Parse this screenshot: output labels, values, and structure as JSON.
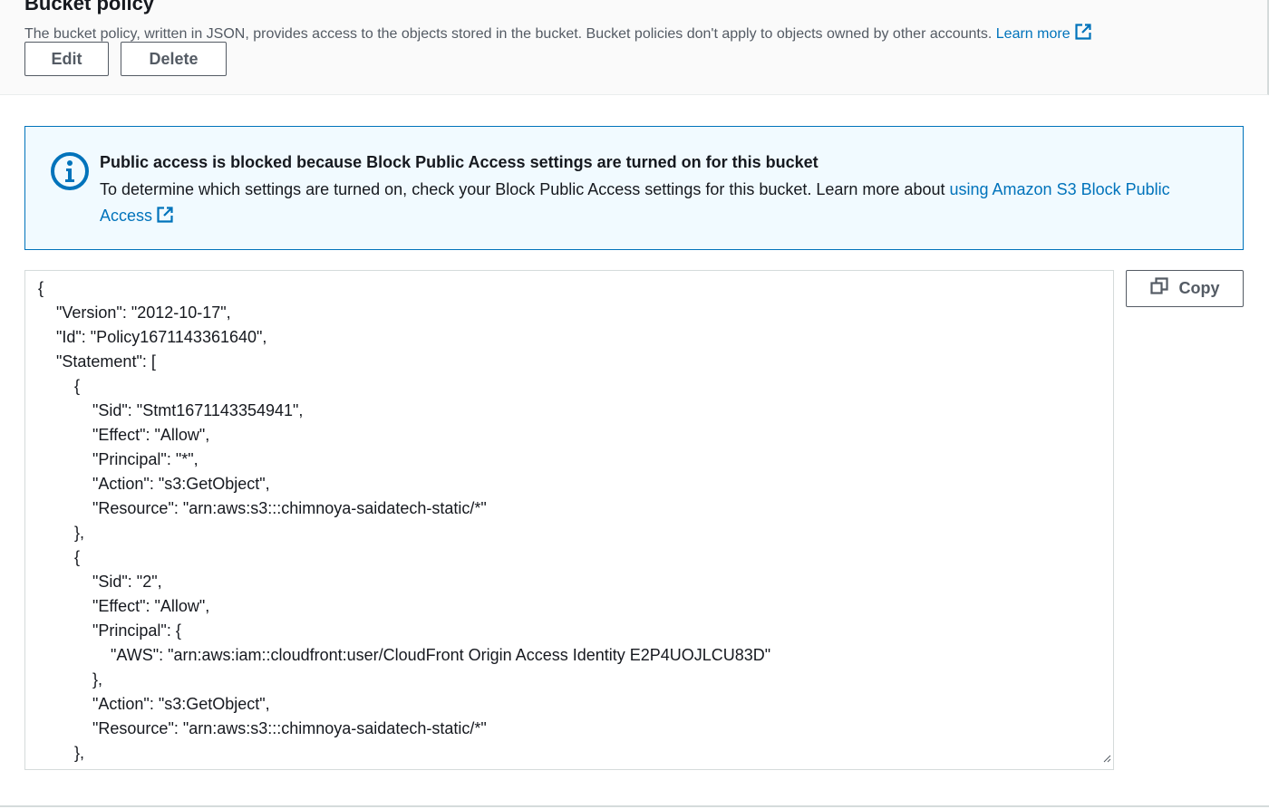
{
  "section": {
    "title": "Bucket policy",
    "description": "The bucket policy, written in JSON, provides access to the objects stored in the bucket. Bucket policies don't apply to objects owned by other accounts.",
    "learn_more": "Learn more",
    "edit_label": "Edit",
    "delete_label": "Delete"
  },
  "alert": {
    "title": "Public access is blocked because Block Public Access settings are turned on for this bucket",
    "body": "To determine which settings are turned on, check your Block Public Access settings for this bucket. Learn more about",
    "link": "using Amazon S3 Block Public Access"
  },
  "editor": {
    "copy_label": "Copy",
    "lines": [
      "{",
      "    \"Version\": \"2012-10-17\",",
      "    \"Id\": \"Policy1671143361640\",",
      "    \"Statement\": [",
      "        {",
      "            \"Sid\": \"Stmt1671143354941\",",
      "            \"Effect\": \"Allow\",",
      "            \"Principal\": \"*\",",
      "            \"Action\": \"s3:GetObject\",",
      "            \"Resource\": \"arn:aws:s3:::chimnoya-saidatech-static/*\"",
      "        },",
      "        {",
      "            \"Sid\": \"2\",",
      "            \"Effect\": \"Allow\",",
      "            \"Principal\": {",
      "                \"AWS\": \"arn:aws:iam::cloudfront:user/CloudFront Origin Access Identity E2P4UOJLCU83D\"",
      "            },",
      "            \"Action\": \"s3:GetObject\",",
      "            \"Resource\": \"arn:aws:s3:::chimnoya-saidatech-static/*\"",
      "        },"
    ]
  },
  "colors": {
    "link": "#0073bb",
    "alert_border": "#0073bb",
    "alert_bg": "#f1faff",
    "button_border": "#545b64"
  },
  "icons": {
    "external": "external-link-icon",
    "info": "info-icon",
    "copy": "copy-icon"
  }
}
